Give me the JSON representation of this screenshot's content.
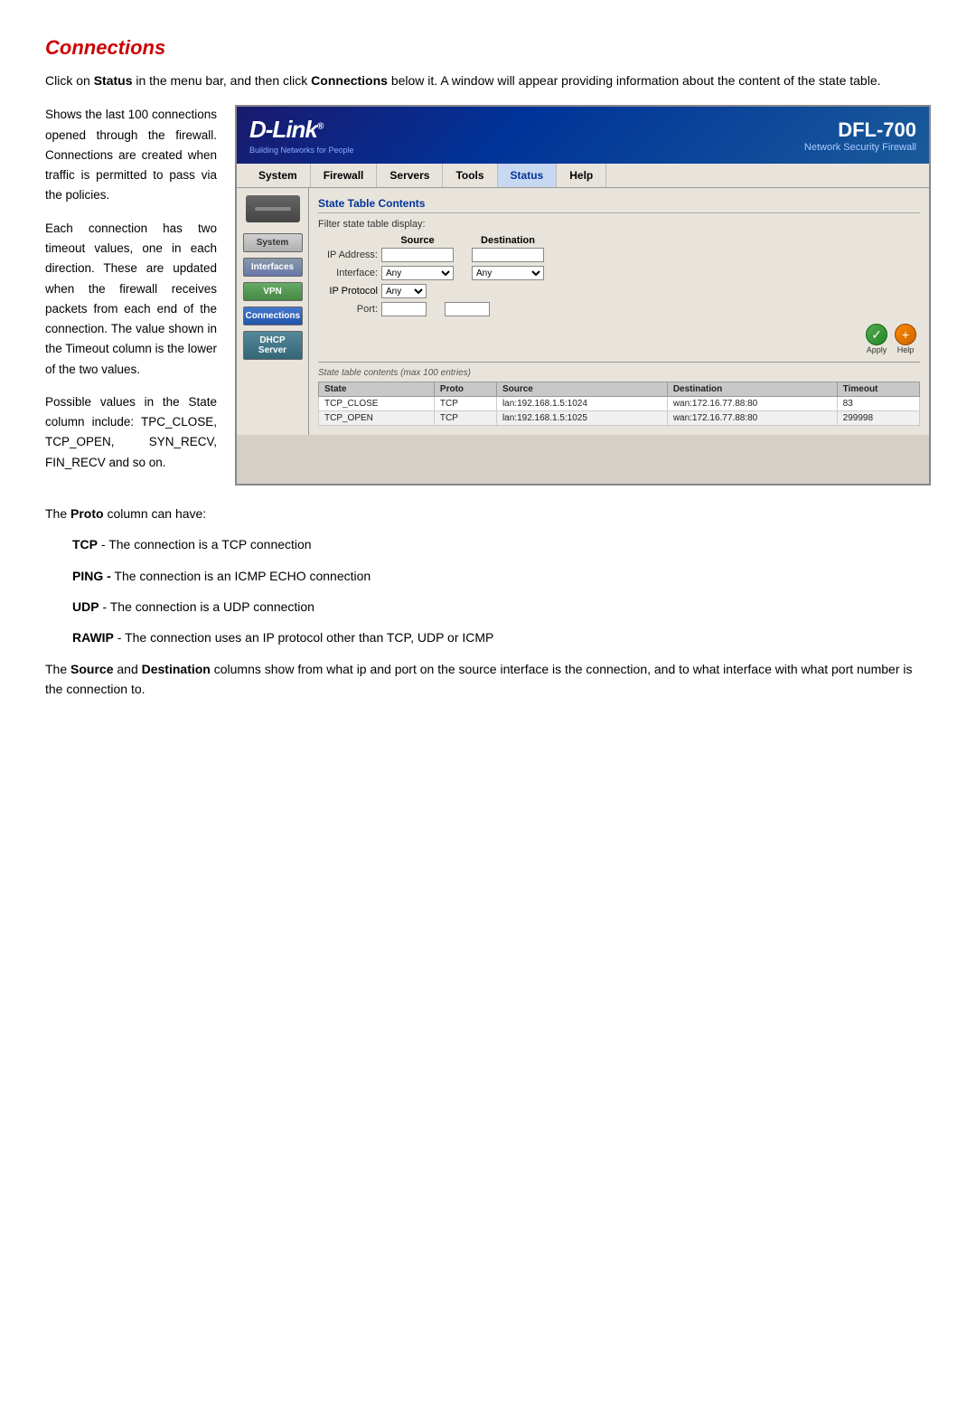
{
  "page": {
    "title": "Connections",
    "intro": [
      "Click on ",
      "Status",
      " in the menu bar, and then click ",
      "Connections",
      " below it. A window will appear providing information about the content of the state table."
    ],
    "left_paragraphs": [
      "Shows the last 100 connections opened through the firewall. Connections are created when traffic is permitted to pass via the policies.",
      "Each connection has two timeout values, one in each direction. These are updated when the firewall receives packets from each end of the connection. The value shown in the Timeout column is the lower of the two values.",
      "Possible values in the State column include: TPC_CLOSE, TCP_OPEN, SYN_RECV, FIN_RECV and so on."
    ],
    "dlink": {
      "logo": "D-Link",
      "logo_reg": "®",
      "tagline": "Building Networks for People",
      "model": "DFL-700",
      "desc": "Network Security Firewall"
    },
    "nav": {
      "items": [
        "System",
        "Firewall",
        "Servers",
        "Tools",
        "Status",
        "Help"
      ]
    },
    "sidebar": {
      "items": [
        "System",
        "Interfaces",
        "VPN",
        "Connections",
        "DHCP Server"
      ]
    },
    "panel": {
      "title": "State Table Contents",
      "filter_label": "Filter state table display:",
      "source_header": "Source",
      "destination_header": "Destination",
      "ip_address_label": "IP Address:",
      "interface_label": "Interface:",
      "ip_protocol_label": "IP Protocol",
      "port_label": "Port:",
      "interface_options": [
        "Any"
      ],
      "ip_protocol_options": [
        "Any"
      ],
      "apply_label": "Apply",
      "help_label": "Help",
      "state_table_note": "State table contents (max 100 entries)",
      "table_headers": [
        "State",
        "Proto",
        "Source",
        "Destination",
        "Timeout"
      ],
      "table_rows": [
        [
          "TCP_CLOSE",
          "TCP",
          "lan:192.168.1.5:1024",
          "wan:172.16.77.88:80",
          "83"
        ],
        [
          "TCP_OPEN",
          "TCP",
          "lan:192.168.1.5:1025",
          "wan:172.16.77.88:80",
          "299998"
        ]
      ]
    },
    "proto_section": {
      "intro": "The ",
      "proto_bold": "Proto",
      "intro2": " column can have:",
      "items": [
        {
          "term": "TCP",
          "def": " - The connection is a TCP connection"
        },
        {
          "term": "PING -",
          "def": " The connection is an ICMP ECHO connection"
        },
        {
          "term": "UDP",
          "def": " - The connection is a UDP connection"
        },
        {
          "term": "RAWIP",
          "def": " - The connection uses an IP protocol other than TCP, UDP or ICMP"
        }
      ],
      "footer": "The ",
      "source_bold": "Source",
      "footer2": " and ",
      "dest_bold": "Destination",
      "footer3": " columns show from what ip and port on the source interface is the connection, and to what interface with what port number is the connection to."
    }
  }
}
